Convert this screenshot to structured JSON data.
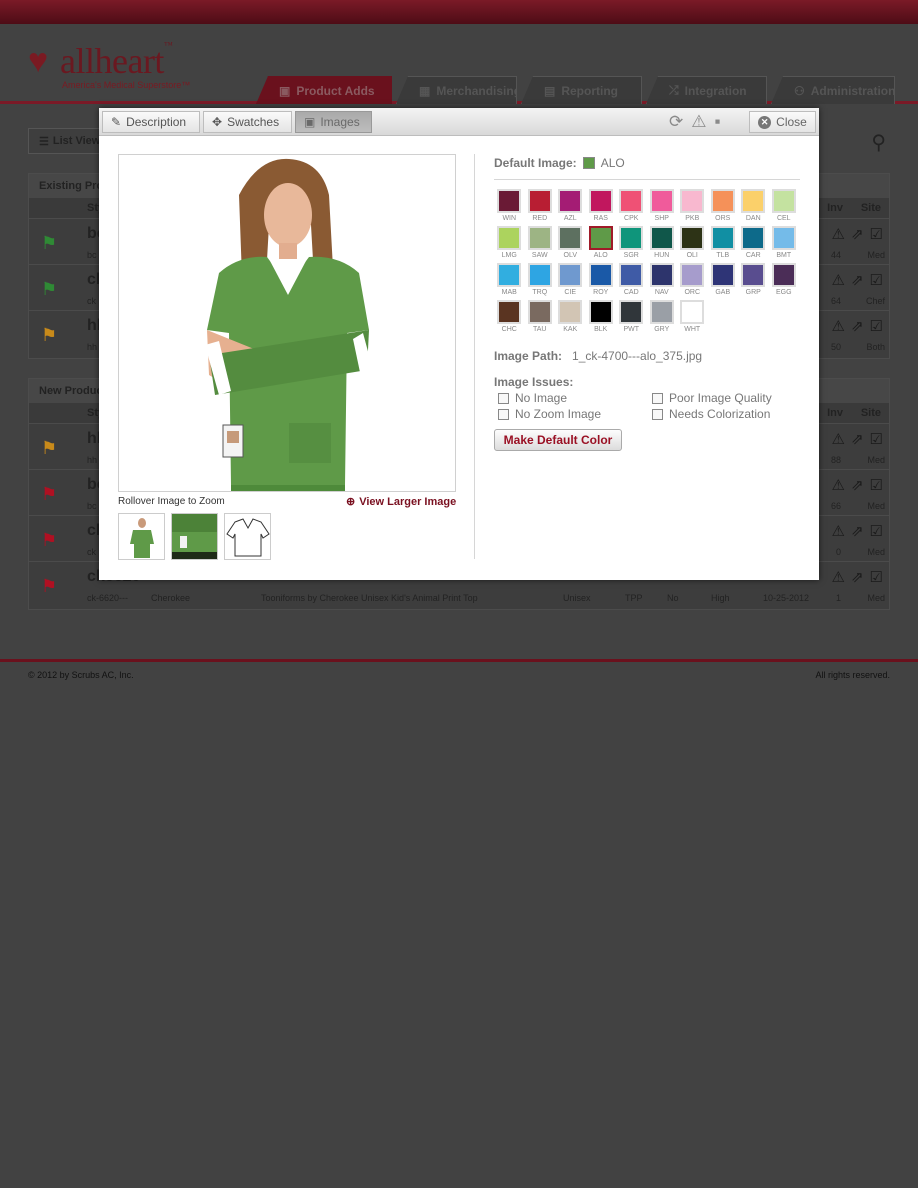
{
  "brand": {
    "logo_text": "allheart",
    "trademark": "™",
    "tagline": "America's Medical Superstore™"
  },
  "nav": {
    "tabs": [
      {
        "label": "Product Adds",
        "icon": "image-icon",
        "active": true
      },
      {
        "label": "Merchandising",
        "icon": "grid-icon",
        "active": false
      },
      {
        "label": "Reporting",
        "icon": "chart-icon",
        "active": false
      },
      {
        "label": "Integration",
        "icon": "shuffle-icon",
        "active": false
      },
      {
        "label": "Administration",
        "icon": "hierarchy-icon",
        "active": false
      }
    ]
  },
  "background": {
    "list_view_label": "List View",
    "existing_panel_title": "Existing Products",
    "new_panel_title": "New Products",
    "col_style": "Style",
    "col_inv": "Inv",
    "col_site": "Site",
    "existing_rows": [
      {
        "flag": "#2f8a35",
        "code": "bc",
        "sub": "bc",
        "inv": "44",
        "site": "Med"
      },
      {
        "flag": "#2f8a35",
        "code": "ck",
        "sub": "ck",
        "inv": "64",
        "site": "Chef"
      },
      {
        "flag": "#c88a1a",
        "code": "hh",
        "sub": "hh",
        "inv": "50",
        "site": "Both"
      }
    ],
    "new_rows": [
      {
        "flag": "#c88a1a",
        "code": "hh",
        "sub": "hh",
        "inv": "88",
        "site": "Med"
      },
      {
        "flag": "#b01022",
        "code": "bc",
        "sub": "bc",
        "inv": "66",
        "site": "Med"
      },
      {
        "flag": "#b01022",
        "code": "ck",
        "sub": "ck",
        "inv": "0",
        "site": "Med"
      },
      {
        "flag": "#b01022",
        "code": "ck6620",
        "sub": "ck-6620---",
        "inv": "1",
        "site": "Med",
        "brand": "Cherokee",
        "desc": "Tooniforms by Cherokee Unisex Kid's Animal Print Top",
        "gender": "Unisex",
        "type": "TPP",
        "flag2": "No",
        "priority": "High",
        "date": "10-25-2012"
      }
    ]
  },
  "footer": {
    "copyright": "© 2012 by Scrubs AC, Inc.",
    "rights": "All rights reserved."
  },
  "modal": {
    "tabs": {
      "description": "Description",
      "swatches": "Swatches",
      "images": "Images"
    },
    "close_label": "Close",
    "zoom_hint": "Rollover Image to Zoom",
    "view_larger": "View Larger Image",
    "default_image_label": "Default Image:",
    "default_image_value": "ALO",
    "default_image_color": "#5f9a48",
    "image_path_label": "Image Path:",
    "image_path_value": "1_ck-4700---alo_375.jpg",
    "image_issues_label": "Image Issues:",
    "issues": [
      "No Image",
      "Poor Image Quality",
      "No Zoom Image",
      "Needs Colorization"
    ],
    "make_default_label": "Make Default Color",
    "selected_swatch": "ALO",
    "swatches": [
      {
        "code": "WIN",
        "color": "#6a1a35"
      },
      {
        "code": "RED",
        "color": "#b81e33"
      },
      {
        "code": "AZL",
        "color": "#a41c74"
      },
      {
        "code": "RAS",
        "color": "#c1175e"
      },
      {
        "code": "CPK",
        "color": "#ef5175"
      },
      {
        "code": "SHP",
        "color": "#f05b9b"
      },
      {
        "code": "PKB",
        "color": "#f8b8cf"
      },
      {
        "code": "ORS",
        "color": "#f59159"
      },
      {
        "code": "DAN",
        "color": "#fbd06a"
      },
      {
        "code": "CEL",
        "color": "#c4e2a0"
      },
      {
        "code": "LMG",
        "color": "#acd35e"
      },
      {
        "code": "SAW",
        "color": "#9db484"
      },
      {
        "code": "OLV",
        "color": "#5d7060"
      },
      {
        "code": "ALO",
        "color": "#5f9a48"
      },
      {
        "code": "SGR",
        "color": "#0f957b"
      },
      {
        "code": "HUN",
        "color": "#10574a"
      },
      {
        "code": "OLI",
        "color": "#2d3316"
      },
      {
        "code": "TLB",
        "color": "#118fa3"
      },
      {
        "code": "CAR",
        "color": "#0d6a8a"
      },
      {
        "code": "BMT",
        "color": "#74bbe9"
      },
      {
        "code": "MAB",
        "color": "#31aee0"
      },
      {
        "code": "TRQ",
        "color": "#2ea5e3"
      },
      {
        "code": "CIE",
        "color": "#6f99cf"
      },
      {
        "code": "ROY",
        "color": "#1a59a7"
      },
      {
        "code": "CAD",
        "color": "#3f5ba6"
      },
      {
        "code": "NAV",
        "color": "#2d346c"
      },
      {
        "code": "ORC",
        "color": "#a69ccc"
      },
      {
        "code": "GAB",
        "color": "#2e3476"
      },
      {
        "code": "GRP",
        "color": "#594d8f"
      },
      {
        "code": "EGG",
        "color": "#4b2d57"
      },
      {
        "code": "CHC",
        "color": "#5a3421"
      },
      {
        "code": "TAU",
        "color": "#7a6a60"
      },
      {
        "code": "KAK",
        "color": "#d2c5b4"
      },
      {
        "code": "BLK",
        "color": "#000000"
      },
      {
        "code": "PWT",
        "color": "#30363a"
      },
      {
        "code": "GRY",
        "color": "#9a9fa6"
      },
      {
        "code": "WHT",
        "color": "#ffffff"
      }
    ]
  }
}
